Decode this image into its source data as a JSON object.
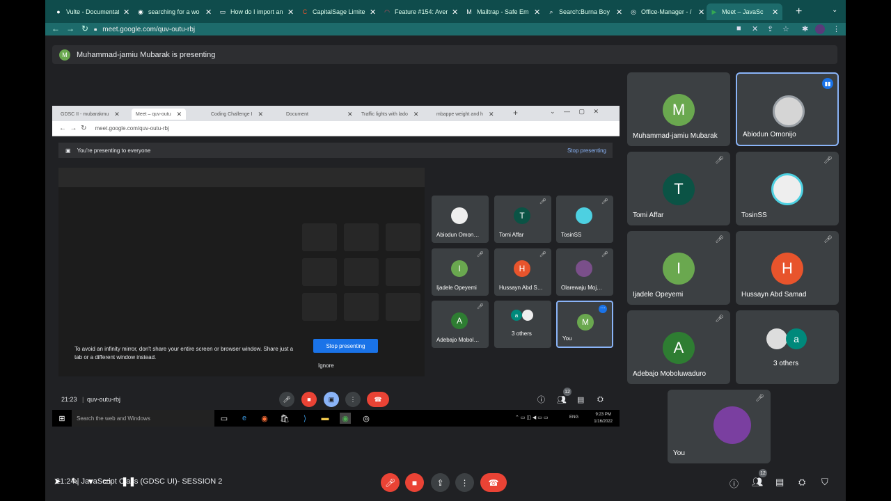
{
  "browser": {
    "tabs": [
      {
        "label": "Vulte - Documentat",
        "icon": "dot-icon"
      },
      {
        "label": "searching for a wo",
        "icon": "chrome-icon"
      },
      {
        "label": "How do I import an",
        "icon": "page-icon"
      },
      {
        "label": "CapitalSage Limite",
        "icon": "c-icon"
      },
      {
        "label": "Feature #154: Aver",
        "icon": "arc-icon"
      },
      {
        "label": "Mailtrap - Safe Em",
        "icon": "mail-icon"
      },
      {
        "label": "Search:Burna Boy",
        "icon": "search-icon"
      },
      {
        "label": "Office-Manager - /",
        "icon": "globe-icon"
      },
      {
        "label": "Meet – JavaSc",
        "icon": "meet-icon"
      }
    ],
    "url": "meet.google.com/quv-outu-rbj"
  },
  "presenting_banner": {
    "avatar": "M",
    "text": "Muhammad-jamiu Mubarak is presenting"
  },
  "shared": {
    "tabs": [
      {
        "label": "GDSC II - mubarakmu"
      },
      {
        "label": "Meet – quv-outu"
      },
      {
        "label": "Coding Challenge I"
      },
      {
        "label": "Document"
      },
      {
        "label": "Traffic lights with lado"
      },
      {
        "label": "mbappe weight and h"
      }
    ],
    "url": "meet.google.com/quv-outu-rbj",
    "banner": "You're presenting to everyone",
    "stop_link": "Stop presenting",
    "mirror_text": "To avoid an infinity mirror, don't share your entire screen or browser window. Share just a tab or a different window instead.",
    "stop_button": "Stop presenting",
    "ignore": "Ignore",
    "tiles": [
      {
        "name": "Abiodun Omon…",
        "initial": "",
        "color": "#ffffff"
      },
      {
        "name": "Tomi Affar",
        "initial": "T",
        "color": "#0b5345"
      },
      {
        "name": "TosinSS",
        "initial": "",
        "color": "#4dd0e1"
      },
      {
        "name": "Ijadele Opeyemi",
        "initial": "I",
        "color": "#6aa84f"
      },
      {
        "name": "Hussayn Abd S…",
        "initial": "H",
        "color": "#e8542c"
      },
      {
        "name": "Olarewaju Moj…",
        "initial": "",
        "color": "#7a4f8a"
      },
      {
        "name": "Adebajo Mobol…",
        "initial": "A",
        "color": "#2e7d32"
      },
      {
        "name": "3 others",
        "initial": "a",
        "color": "#00897b"
      },
      {
        "name": "You",
        "initial": "M",
        "color": "#6aa84f"
      }
    ],
    "time": "21:23",
    "code": "quv-outu-rbj",
    "people_count": "12",
    "taskbar_search": "Search the web and Windows",
    "clock_time": "9:23 PM",
    "clock_date": "1/16/2022",
    "lang": "ENG"
  },
  "tiles": [
    {
      "name": "Muhammad-jamiu Mubarak",
      "initial": "M",
      "color": "#6aa84f"
    },
    {
      "name": "Abiodun Omonijo",
      "initial": "",
      "color": "#cccccc"
    },
    {
      "name": "Tomi Affar",
      "initial": "T",
      "color": "#0b5345"
    },
    {
      "name": "TosinSS",
      "initial": "",
      "color": "#4dd0e1"
    },
    {
      "name": "Ijadele Opeyemi",
      "initial": "I",
      "color": "#6aa84f"
    },
    {
      "name": "Hussayn Abd Samad",
      "initial": "H",
      "color": "#e8542c"
    },
    {
      "name": "Adebajo Moboluwaduro",
      "initial": "A",
      "color": "#2e7d32"
    },
    {
      "name": "3 others",
      "initial": "a",
      "color": "#00897b"
    },
    {
      "name": "You",
      "initial": "",
      "color": "#7a3fa0"
    }
  ],
  "bottom": {
    "meeting_name": "21:24 | JavaScript Class (GDSC UI)- SESSION 2",
    "people_count": "12"
  }
}
